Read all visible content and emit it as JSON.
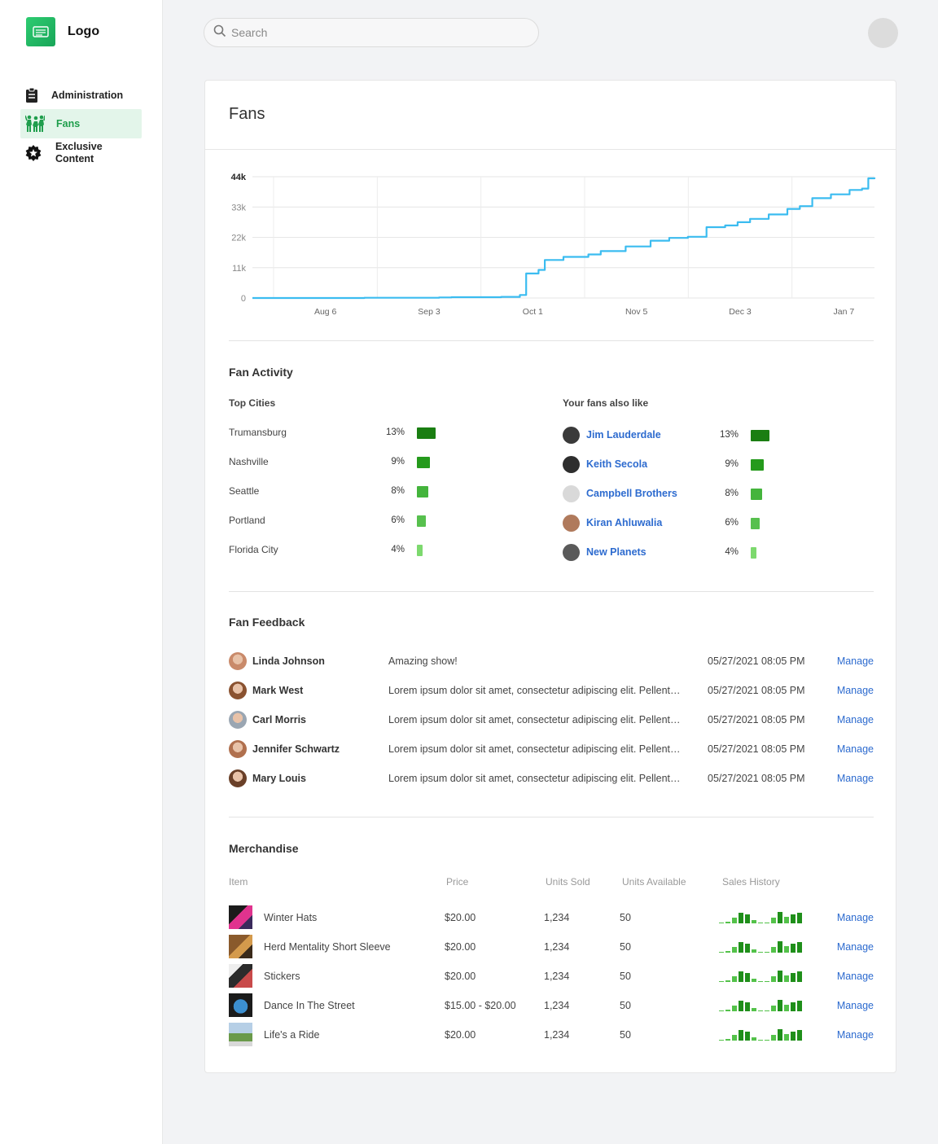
{
  "app": {
    "logo_text": "Logo"
  },
  "sidebar": {
    "items": [
      {
        "label": "Administration",
        "icon": "clipboard-icon"
      },
      {
        "label": "Fans",
        "icon": "people-icon",
        "active": true
      },
      {
        "label": "Exclusive Content",
        "icon": "star-badge-icon"
      }
    ]
  },
  "search": {
    "placeholder": "Search",
    "value": ""
  },
  "page": {
    "title": "Fans"
  },
  "chart_data": {
    "type": "line",
    "x_tick_labels": [
      "Aug 6",
      "Sep 3",
      "Oct 1",
      "Nov 5",
      "Dec 3",
      "Jan 7"
    ],
    "y_tick_labels": [
      "0",
      "11k",
      "22k",
      "33k",
      "44k"
    ],
    "ylim": [
      0,
      44000
    ],
    "color": "#3bbcf0",
    "series": [
      {
        "values": [
          [
            0,
            0
          ],
          [
            0.18,
            80
          ],
          [
            0.3,
            200
          ],
          [
            0.32,
            300
          ],
          [
            0.4,
            400
          ],
          [
            0.43,
            1100
          ],
          [
            0.44,
            8900
          ],
          [
            0.46,
            10200
          ],
          [
            0.47,
            13800
          ],
          [
            0.5,
            14900
          ],
          [
            0.54,
            15800
          ],
          [
            0.56,
            17000
          ],
          [
            0.6,
            18700
          ],
          [
            0.64,
            20800
          ],
          [
            0.67,
            21800
          ],
          [
            0.7,
            22200
          ],
          [
            0.73,
            25700
          ],
          [
            0.76,
            26300
          ],
          [
            0.78,
            27500
          ],
          [
            0.8,
            28700
          ],
          [
            0.83,
            30300
          ],
          [
            0.86,
            32300
          ],
          [
            0.88,
            33300
          ],
          [
            0.9,
            36200
          ],
          [
            0.93,
            37600
          ],
          [
            0.96,
            39200
          ],
          [
            0.98,
            39700
          ],
          [
            0.99,
            43400
          ],
          [
            1.0,
            43700
          ]
        ]
      }
    ],
    "grid": true
  },
  "activity": {
    "title": "Fan Activity",
    "cities_title": "Top Cities",
    "cities": [
      {
        "name": "Trumansburg",
        "pct": "13%",
        "value": 13,
        "color": "#1a7e12"
      },
      {
        "name": "Nashville",
        "pct": "9%",
        "value": 9,
        "color": "#259a1c"
      },
      {
        "name": "Seattle",
        "pct": "8%",
        "value": 8,
        "color": "#44b43c"
      },
      {
        "name": "Portland",
        "pct": "6%",
        "value": 6,
        "color": "#57c04e"
      },
      {
        "name": "Florida City",
        "pct": "4%",
        "value": 4,
        "color": "#7dd96e"
      }
    ],
    "also_like_title": "Your fans also like",
    "artists": [
      {
        "name": "Jim Lauderdale",
        "pct": "13%",
        "value": 13,
        "color": "#1a7e12"
      },
      {
        "name": "Keith Secola",
        "pct": "9%",
        "value": 9,
        "color": "#259a1c"
      },
      {
        "name": "Campbell Brothers",
        "pct": "8%",
        "value": 8,
        "color": "#44b43c"
      },
      {
        "name": "Kiran Ahluwalia",
        "pct": "6%",
        "value": 6,
        "color": "#57c04e"
      },
      {
        "name": "New Planets",
        "pct": "4%",
        "value": 4,
        "color": "#7dd96e"
      }
    ]
  },
  "feedback": {
    "title": "Fan Feedback",
    "rows": [
      {
        "name": "Linda Johnson",
        "message": "Amazing show!",
        "date": "05/27/2021 08:05 PM",
        "action": "Manage"
      },
      {
        "name": "Mark West",
        "message": "Lorem ipsum dolor sit amet, consectetur adipiscing elit. Pellentesque",
        "date": "05/27/2021 08:05 PM",
        "action": "Manage"
      },
      {
        "name": "Carl Morris",
        "message": "Lorem ipsum dolor sit amet, consectetur adipiscing elit. Pellentesque",
        "date": "05/27/2021 08:05 PM",
        "action": "Manage"
      },
      {
        "name": "Jennifer Schwartz",
        "message": "Lorem ipsum dolor sit amet, consectetur adipiscing elit. Pellentesque",
        "date": "05/27/2021 08:05 PM",
        "action": "Manage"
      },
      {
        "name": "Mary Louis",
        "message": "Lorem ipsum dolor sit amet, consectetur adipiscing elit. Pellentesque",
        "date": "05/27/2021 08:05 PM",
        "action": "Manage"
      }
    ]
  },
  "merchandise": {
    "title": "Merchandise",
    "headers": [
      "Item",
      "Price",
      "Units Sold",
      "Units Available",
      "Sales History"
    ],
    "rows": [
      {
        "item": "Winter Hats",
        "price": "$20.00",
        "sold": "1,234",
        "available": "50",
        "action": "Manage"
      },
      {
        "item": "Herd Mentality Short Sleeve",
        "price": "$20.00",
        "sold": "1,234",
        "available": "50",
        "action": "Manage"
      },
      {
        "item": "Stickers",
        "price": "$20.00",
        "sold": "1,234",
        "available": "50",
        "action": "Manage"
      },
      {
        "item": "Dance In The Street",
        "price": "$15.00 - $20.00",
        "sold": "1,234",
        "available": "50",
        "action": "Manage"
      },
      {
        "item": "Life's a Ride",
        "price": "$20.00",
        "sold": "1,234",
        "available": "50",
        "action": "Manage"
      }
    ],
    "sales_history": [
      1,
      2,
      6,
      11,
      9,
      3,
      1,
      1,
      6,
      12,
      7,
      9,
      11
    ]
  }
}
